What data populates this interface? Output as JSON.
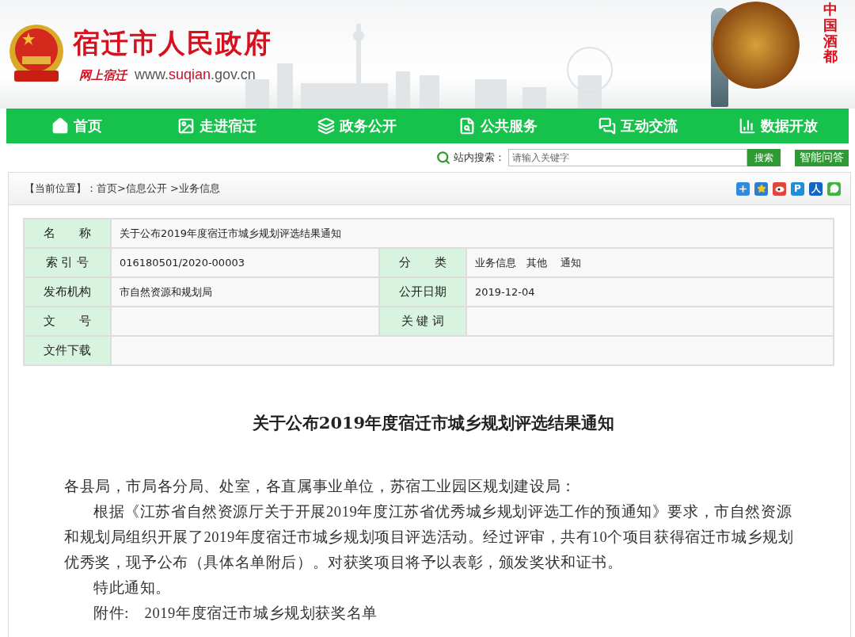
{
  "header": {
    "site_title": "宿迁市人民政府",
    "slogan": "网上宿迁",
    "url": {
      "prefix": "www.",
      "highlight": "suqian",
      "suffix": ".gov.cn"
    },
    "badge_text": "中国酒都"
  },
  "nav": [
    {
      "kind": "home",
      "label": "首页"
    },
    {
      "kind": "image",
      "label": "走进宿迁"
    },
    {
      "kind": "stack",
      "label": "政务公开"
    },
    {
      "kind": "doc-search",
      "label": "公共服务"
    },
    {
      "kind": "chat",
      "label": "互动交流"
    },
    {
      "kind": "chart-search",
      "label": "数据开放"
    }
  ],
  "search": {
    "label": "站内搜索：",
    "placeholder": "请输入关键字",
    "button": "搜索"
  },
  "qa_button": "智能问答",
  "breadcrumb": {
    "label": "【当前位置】",
    "separator": "：",
    "path": "首页>信息公开 >业务信息"
  },
  "share": [
    {
      "kind": "plus",
      "color": "#2f8be0"
    },
    {
      "kind": "star",
      "color": "#2a7fd4"
    },
    {
      "kind": "weibo",
      "color": "#e0463c"
    },
    {
      "kind": "glyph",
      "color": "#1c8fd8",
      "glyph": "P"
    },
    {
      "kind": "glyph",
      "color": "#1265c4",
      "glyph": "人"
    },
    {
      "kind": "wechat",
      "color": "#3fb63b"
    }
  ],
  "info_table": [
    {
      "cells": [
        {
          "label": "名　　称",
          "value": "关于公布2019年度宿迁市城乡规划评选结果通知"
        }
      ]
    },
    {
      "cells": [
        {
          "label": "索 引 号",
          "value": "016180501/2020-00003"
        },
        {
          "label": "分　　类",
          "value": "业务信息　其他　 通知"
        }
      ]
    },
    {
      "cells": [
        {
          "label": "发布机构",
          "value": "市自然资源和规划局"
        },
        {
          "label": "公开日期",
          "value": "2019-12-04"
        }
      ]
    },
    {
      "cells": [
        {
          "label": "文　　号"
        },
        {
          "label": "关 键 词"
        }
      ]
    },
    {
      "cells": [
        {
          "label": "文件下载"
        }
      ]
    }
  ],
  "article": {
    "title": "关于公布2019年度宿迁市城乡规划评选结果通知",
    "paragraphs": [
      {
        "text": "各县局，市局各分局、处室，各直属事业单位，苏宿工业园区规划建设局：",
        "indent": false
      },
      {
        "text": "根据《江苏省自然资源厅关于开展2019年度江苏省优秀城乡规划评选工作的预通知》要求，市自然资源和规划局组织开展了2019年度宿迁市城乡规划项目评选活动。经过评审，共有10个项目获得宿迁市城乡规划优秀奖，现予公布（具体名单附后）。对获奖项目将予以表彰，颁发奖状和证书。",
        "indent": true
      },
      {
        "text": "特此通知。",
        "indent": true
      },
      {
        "text": "附件:　2019年度宿迁市城乡规划获奖名单",
        "indent": true
      }
    ]
  }
}
